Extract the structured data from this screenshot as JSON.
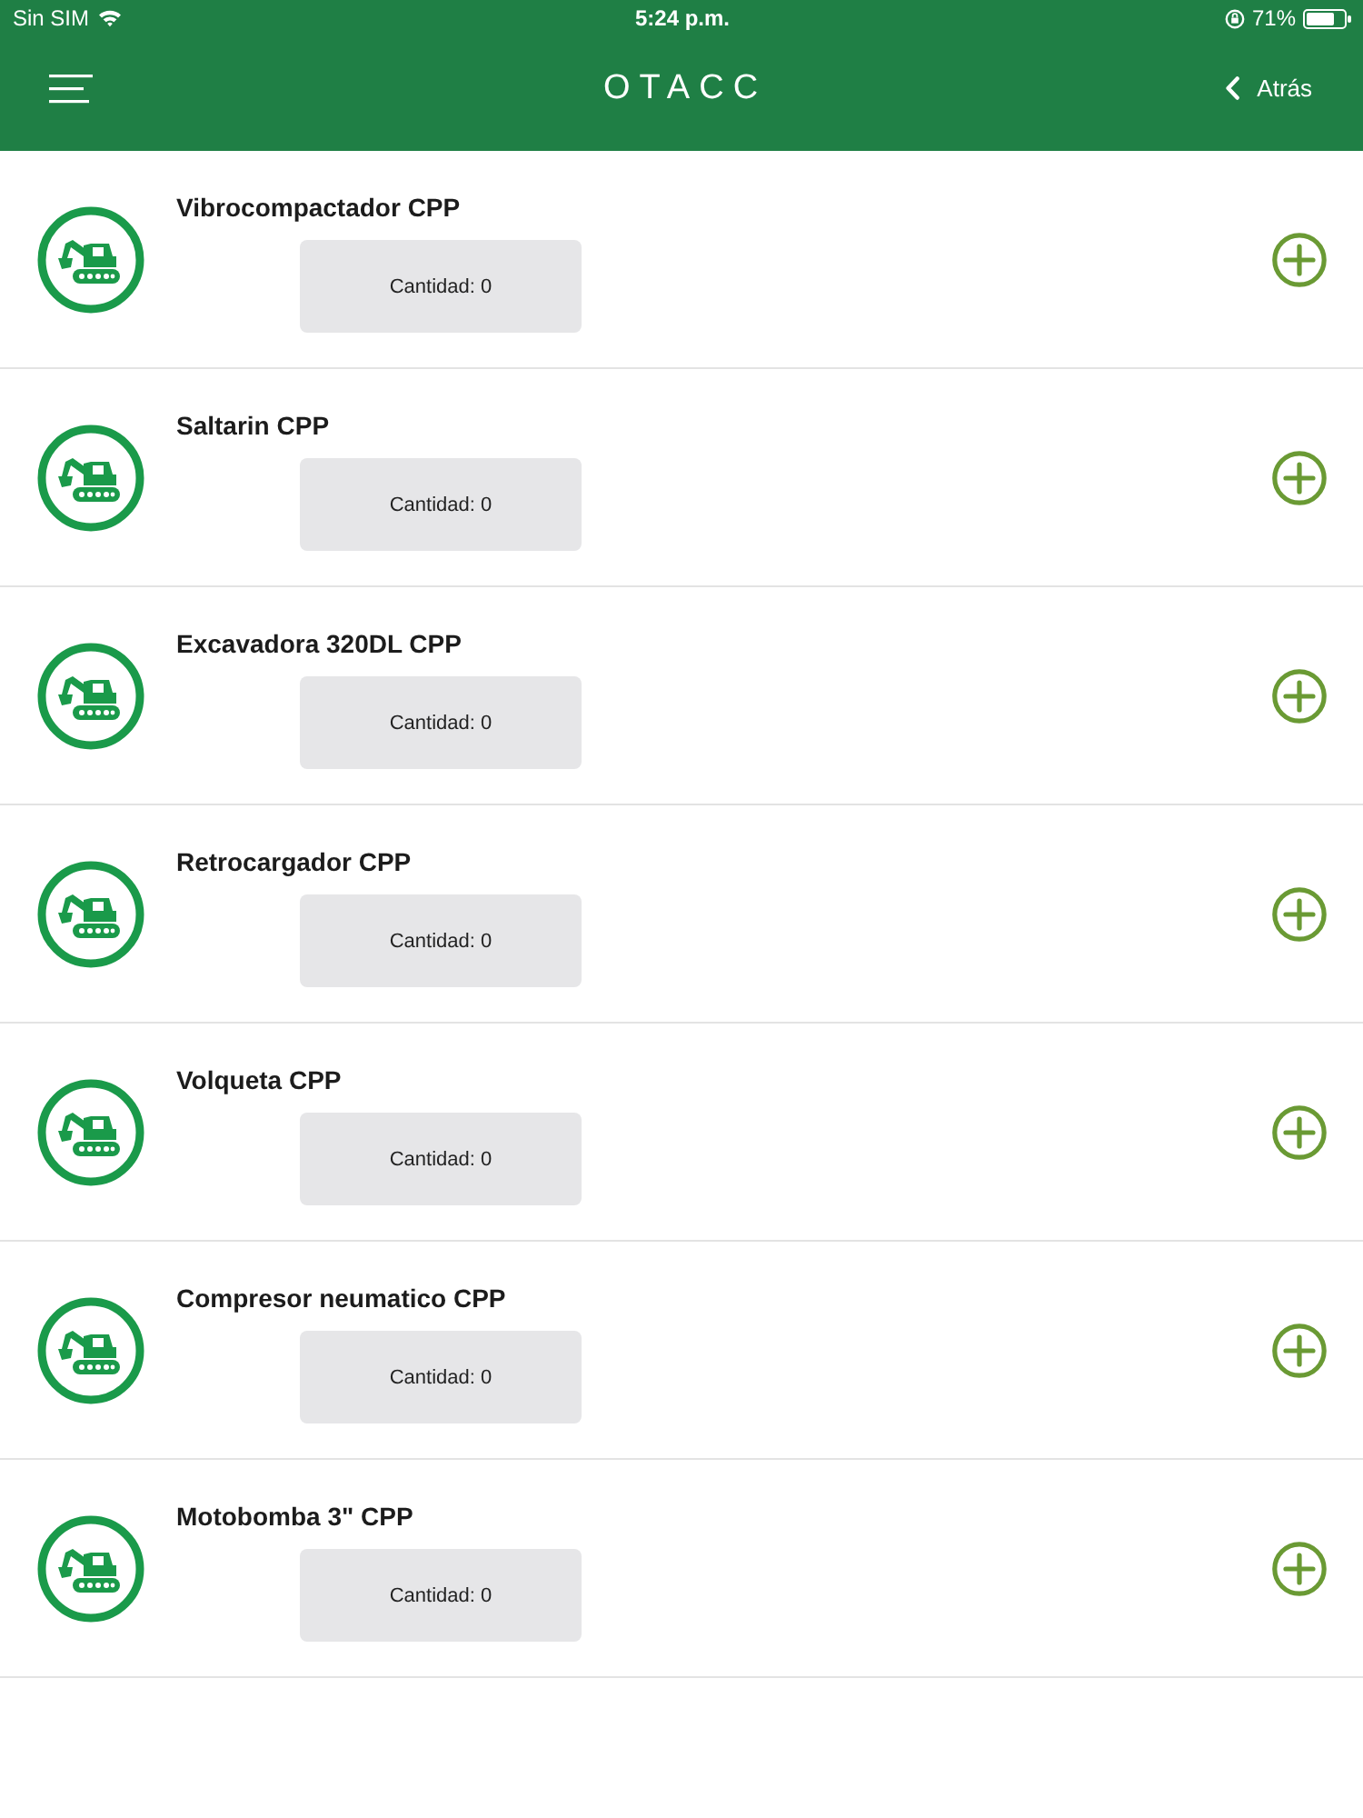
{
  "status_bar": {
    "carrier": "Sin SIM",
    "time": "5:24 p.m.",
    "battery": "71%"
  },
  "nav_bar": {
    "logo": "OTACC",
    "back": "Atrás"
  },
  "items": [
    {
      "name": "Vibrocompactador CPP",
      "quantity": "Cantidad: 0"
    },
    {
      "name": "Saltarin CPP",
      "quantity": "Cantidad: 0"
    },
    {
      "name": "Excavadora 320DL CPP",
      "quantity": "Cantidad: 0"
    },
    {
      "name": "Retrocargador CPP",
      "quantity": "Cantidad: 0"
    },
    {
      "name": "Volqueta CPP",
      "quantity": "Cantidad: 0"
    },
    {
      "name": "Compresor neumatico CPP",
      "quantity": "Cantidad: 0"
    },
    {
      "name": "Motobomba 3\" CPP",
      "quantity": "Cantidad: 0"
    }
  ]
}
